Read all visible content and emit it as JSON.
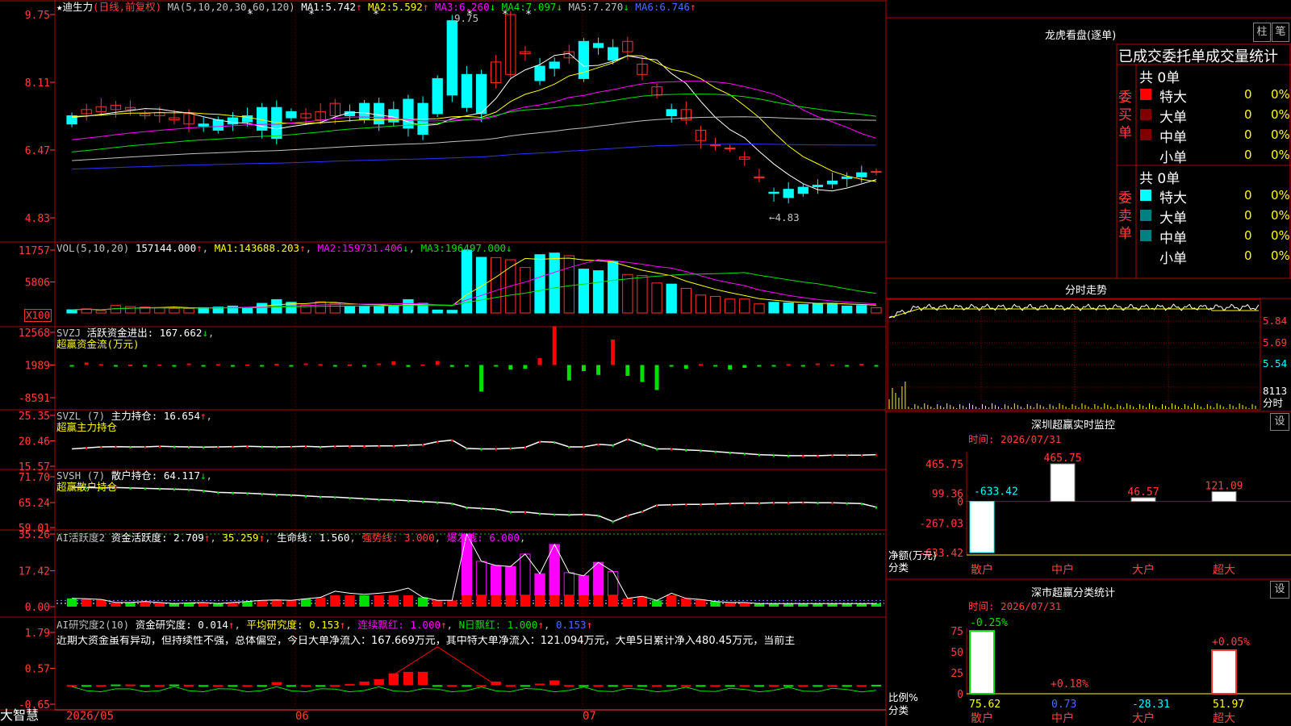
{
  "colors": {
    "up": "#ff3030",
    "down": "#00ffff",
    "ma1": "#ffffff",
    "ma2": "#ffff00",
    "ma3": "#ff00ff",
    "ma4": "#00e000",
    "ma5": "#c0c0c0",
    "ma6": "#3030ff",
    "border": "#b00000"
  },
  "header": {
    "name": "迪生力",
    "period": "(日线,前复权)",
    "ma_params": "MA(5,10,20,30,60,120)",
    "ma": [
      {
        "label": "MA1:",
        "value": "5.742",
        "arrow": "↑"
      },
      {
        "label": "MA2:",
        "value": "5.592",
        "arrow": "↑"
      },
      {
        "label": "MA3:",
        "value": "6.260",
        "arrow": "↓"
      },
      {
        "label": "MA4:",
        "value": "7.097",
        "arrow": "↓"
      },
      {
        "label": "MA5:",
        "value": "7.270",
        "arrow": "↓"
      },
      {
        "label": "MA6:",
        "value": "6.746",
        "arrow": "↑"
      }
    ]
  },
  "price_axis": [
    "9.75",
    "8.11",
    "6.47",
    "4.83"
  ],
  "price_annotations": {
    "high": "9.75",
    "low": "←4.83"
  },
  "vol_panel": {
    "title": "VOL(5,10,20)",
    "value": "157144.000",
    "ma": [
      {
        "label": "MA1:",
        "value": "143688.203",
        "arrow": "↑"
      },
      {
        "label": "MA2:",
        "value": "159731.406",
        "arrow": "↓"
      },
      {
        "label": "MA3:",
        "value": "196497.000",
        "arrow": "↓"
      }
    ],
    "axis": [
      "11757",
      "5806"
    ],
    "unit": "X100"
  },
  "svzj_panel": {
    "title": "SVZJ",
    "label": "活跃资金进出:",
    "value": "167.662",
    "arrow": "↓",
    "subtitle": "超赢资金流(万元)",
    "axis": [
      "12568",
      "1989",
      "-8591"
    ]
  },
  "svzl_panel": {
    "title": "SVZL (7)",
    "label": "主力持仓:",
    "value": "16.654",
    "arrow": "↑",
    "subtitle": "超赢主力持仓",
    "axis": [
      "25.35",
      "20.46",
      "15.57"
    ]
  },
  "svsh_panel": {
    "title": "SVSH (7)",
    "label": "散户持仓:",
    "value": "64.117",
    "arrow": "↓",
    "subtitle": "超赢散户持仓",
    "axis": [
      "71.70",
      "65.24",
      "59.01"
    ]
  },
  "ai_hyd_panel": {
    "title": "AI活跃度2",
    "label": "资金活跃度:",
    "value": "2.709",
    "arrow": "↑",
    "v2": "35.259",
    "life_label": "生命线:",
    "life": "1.560",
    "strong_label": "强势线:",
    "strong": "3.000",
    "burst_label": "爆发线:",
    "burst": "6.000",
    "axis": [
      "35.26",
      "17.42",
      "0.00"
    ]
  },
  "ai_yjd_panel": {
    "title": "AI研究度2(10)",
    "label": "资金研究度:",
    "value": "0.014",
    "arrow": "↑",
    "avg_label": "平均研究度:",
    "avg": "0.153",
    "red_label": "连续飘红:",
    "red": "1.000",
    "nred_label": "N日飘红:",
    "nred": "1.000",
    "last": "0.153",
    "axis": [
      "1.79",
      "0.57",
      "-0.65"
    ],
    "commentary": "近期大资金虽有异动，但持续性不强，总体偏空，今日大单净流入：167.669万元，其中特大单净流入：121.094万元，大单5日累计净入480.45万元，当前主"
  },
  "footer": {
    "brand": "大智慧",
    "dates": [
      "2026/05",
      "06",
      "07"
    ]
  },
  "lhb": {
    "title": "龙虎看盘(逐单)",
    "btn_zhu": "柱",
    "btn_bi": "笔",
    "subtitle": "已成交委托单成交量统计",
    "buy": {
      "side_label": "委买单",
      "total": "共 0单",
      "rows": [
        {
          "name": "特大",
          "count": "0",
          "pct": "0%"
        },
        {
          "name": "大单",
          "count": "0",
          "pct": "0%"
        },
        {
          "name": "中单",
          "count": "0",
          "pct": "0%"
        },
        {
          "name": "小单",
          "count": "0",
          "pct": "0%"
        }
      ]
    },
    "sell": {
      "side_label": "委卖单",
      "total": "共 0单",
      "rows": [
        {
          "name": "特大",
          "count": "0",
          "pct": "0%"
        },
        {
          "name": "大单",
          "count": "0",
          "pct": "0%"
        },
        {
          "name": "中单",
          "count": "0",
          "pct": "0%"
        },
        {
          "name": "小单",
          "count": "0",
          "pct": "0%"
        }
      ]
    }
  },
  "intraday": {
    "title": "分时走势",
    "axis": [
      "5.84",
      "5.69",
      "5.54"
    ],
    "vol": "8113",
    "vol_label": "分时"
  },
  "sz_monitor": {
    "title": "深圳超赢实时监控",
    "btn": "设",
    "time": "时间: 2026/07/31",
    "axis": [
      "465.75",
      "99.36",
      "0",
      "-267.03",
      "-633.42"
    ],
    "ylabel": "净额(万元)",
    "xlabel": "分类",
    "categories": [
      "散户",
      "中户",
      "大户",
      "超大"
    ],
    "values": [
      "-633.42",
      "465.75",
      "46.57",
      "121.09"
    ]
  },
  "sz_class": {
    "title": "深市超赢分类统计",
    "btn": "设",
    "time": "时间: 2026/07/31",
    "axis": [
      "75",
      "50",
      "25",
      "0"
    ],
    "ylabel": "比例%",
    "xlabel": "分类",
    "categories": [
      "散户",
      "中户",
      "大户",
      "超大"
    ],
    "values": [
      "75.62",
      "0.73",
      "-28.31",
      "51.97"
    ],
    "changes": [
      "-0.25%",
      "+0.18%",
      "",
      "+0.05%"
    ]
  },
  "chart_data": [
    {
      "type": "candlestick",
      "title": "迪生力 (日线,前复权)",
      "ylim": [
        4.83,
        9.75
      ],
      "open": [
        7.3,
        7.35,
        7.4,
        7.45,
        7.45,
        7.3,
        7.3,
        7.2,
        7.1,
        7.1,
        7.2,
        7.25,
        7.3,
        7.5,
        7.5,
        7.4,
        7.25,
        7.2,
        7.3,
        7.4,
        7.6,
        7.6,
        7.45,
        7.7,
        7.6,
        8.2,
        9.6,
        8.3,
        8.3,
        8.1,
        8.3,
        8.8,
        8.5,
        8.6,
        8.7,
        9.1,
        9.05,
        8.95,
        8.85,
        8.3,
        7.8,
        7.45,
        7.2,
        6.7,
        6.6,
        6.5,
        6.25,
        5.8,
        5.45,
        5.52,
        5.57,
        5.62,
        5.72,
        5.82,
        5.92,
        5.94
      ],
      "close": [
        7.1,
        7.45,
        7.52,
        7.55,
        7.5,
        7.35,
        7.38,
        7.25,
        7.35,
        7.05,
        6.95,
        7.1,
        7.15,
        6.95,
        6.75,
        7.25,
        7.35,
        7.4,
        7.6,
        7.3,
        7.2,
        7.1,
        7.15,
        7.0,
        6.85,
        7.35,
        7.8,
        7.5,
        7.35,
        8.6,
        9.75,
        8.85,
        8.15,
        8.45,
        8.85,
        8.2,
        8.95,
        8.65,
        9.1,
        8.55,
        8.0,
        7.3,
        7.45,
        6.95,
        6.6,
        6.52,
        6.3,
        5.82,
        5.42,
        5.32,
        5.42,
        5.58,
        5.65,
        5.78,
        5.82,
        5.95
      ]
    },
    {
      "type": "bar",
      "title": "VOL(5,10,20)",
      "ylim": [
        0,
        11757
      ],
      "values": [
        600,
        780,
        450,
        1400,
        1200,
        1100,
        1000,
        850,
        820,
        1000,
        1100,
        1300,
        950,
        1800,
        2500,
        2000,
        1500,
        2100,
        1800,
        1300,
        1300,
        1300,
        1400,
        2500,
        1800,
        550,
        500,
        11757,
        10400,
        10350,
        9950,
        8500,
        10900,
        11200,
        10700,
        8200,
        7900,
        9650,
        7200,
        7000,
        5600,
        5400,
        4600,
        3350,
        3100,
        2600,
        2600,
        1700,
        2000,
        1900,
        1600,
        1800,
        1800,
        1300,
        1400,
        1000
      ]
    },
    {
      "type": "bar",
      "title": "超赢资金流(万元)",
      "values": [
        -500,
        800,
        300,
        -200,
        100,
        -300,
        200,
        -100,
        500,
        -200,
        300,
        -400,
        200,
        -300,
        400,
        -200,
        500,
        300,
        -300,
        200,
        -400,
        500,
        1200,
        -600,
        200,
        1300,
        -600,
        -200,
        -8591,
        -200,
        -1500,
        -1200,
        2200,
        12568,
        -5000,
        -2000,
        -3200,
        8200,
        -3500,
        -5500,
        -8100,
        -300,
        -1200,
        300,
        -500,
        -1500,
        -900,
        -200,
        -400,
        300,
        -200,
        500,
        200,
        -300,
        400,
        -200
      ]
    },
    {
      "type": "line",
      "title": "超赢主力持仓",
      "ylim": [
        15.57,
        25.35
      ],
      "values": [
        18.9,
        19.1,
        19.3,
        19.35,
        19.3,
        19.3,
        19.4,
        19.35,
        19.3,
        19.25,
        19.3,
        19.35,
        19.4,
        19.35,
        19.3,
        19.35,
        19.4,
        19.3,
        19.4,
        19.45,
        19.45,
        19.5,
        19.5,
        19.6,
        19.7,
        20.3,
        20.6,
        19.0,
        18.9,
        18.9,
        19.0,
        19.2,
        20.3,
        20.2,
        19.3,
        19.3,
        19.8,
        19.6,
        20.8,
        19.8,
        18.9,
        18.9,
        18.7,
        18.6,
        18.4,
        18.2,
        18.0,
        17.8,
        17.7,
        17.6,
        17.6,
        17.6,
        17.7,
        17.7,
        17.7,
        17.8
      ]
    },
    {
      "type": "line",
      "title": "超赢散户持仓",
      "ylim": [
        59.01,
        71.7
      ],
      "values": [
        69.1,
        69.0,
        68.9,
        69.0,
        68.9,
        68.8,
        68.7,
        68.6,
        68.5,
        68.2,
        67.8,
        67.7,
        67.6,
        67.4,
        67.2,
        67.1,
        66.9,
        66.7,
        66.6,
        66.4,
        66.2,
        66.0,
        65.9,
        65.7,
        65.5,
        65.3,
        65.0,
        64.0,
        63.8,
        63.6,
        62.9,
        62.9,
        62.5,
        62.3,
        62.2,
        62.3,
        62.0,
        60.5,
        62.0,
        63.0,
        64.6,
        64.7,
        64.8,
        64.8,
        64.9,
        65.0,
        65.1,
        65.1,
        65.2,
        65.2,
        65.3,
        65.2,
        65.2,
        65.1,
        65.0,
        64.1
      ]
    },
    {
      "type": "bar",
      "title": "AI活跃度2",
      "ylim": [
        0,
        35.26
      ],
      "values": [
        4,
        3.8,
        3.5,
        2,
        2,
        2.5,
        2,
        1.5,
        1.8,
        2,
        1.5,
        2,
        2.5,
        3,
        3.2,
        3,
        3.8,
        4.5,
        7.5,
        6.5,
        6,
        6.5,
        7.2,
        9,
        4.5,
        3,
        3,
        35.26,
        22,
        20,
        19.5,
        25.5,
        16,
        30.2,
        16.5,
        15,
        21.5,
        17,
        4,
        5,
        3,
        6.5,
        4,
        3.5,
        2.5,
        2,
        2,
        1.5,
        1.5,
        1.5,
        1.5,
        1.5,
        1.5,
        1.5,
        1.5,
        1.5
      ]
    },
    {
      "type": "bar",
      "title": "AI研究度2(10)",
      "ylim": [
        -0.65,
        1.79
      ],
      "values": [
        -0.02,
        -0.02,
        -0.02,
        0.02,
        0.02,
        -0.02,
        -0.02,
        0.02,
        0.01,
        -0.02,
        -0.02,
        -0.02,
        -0.02,
        -0.02,
        0.1,
        -0.02,
        -0.02,
        -0.02,
        -0.02,
        0.04,
        0.12,
        0.2,
        0.4,
        0.45,
        0.45,
        -0.02,
        -0.02,
        -0.02,
        -0.02,
        0.12,
        -0.02,
        -0.02,
        0.05,
        0.16,
        -0.02,
        -0.02,
        -0.02,
        -0.02,
        -0.02,
        -0.02,
        -0.02,
        -0.02,
        -0.02,
        -0.02,
        -0.02,
        -0.02,
        -0.02,
        -0.02,
        -0.02,
        -0.02,
        -0.02,
        -0.02,
        -0.02,
        -0.02,
        -0.02,
        0.01
      ]
    }
  ]
}
